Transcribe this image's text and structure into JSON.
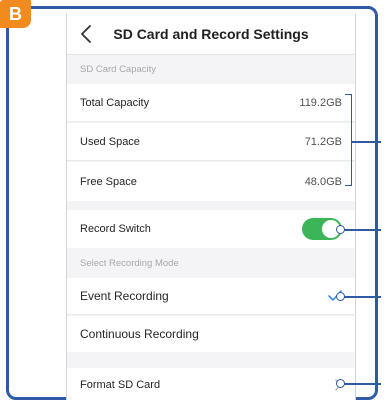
{
  "badge": "B",
  "header": {
    "title": "SD Card and Record Settings"
  },
  "capacity": {
    "section_label": "SD Card Capacity",
    "rows": [
      {
        "label": "Total Capacity",
        "value": "119.2GB"
      },
      {
        "label": "Used Space",
        "value": "71.2GB"
      },
      {
        "label": "Free Space",
        "value": "48.0GB"
      }
    ]
  },
  "record": {
    "label": "Record Switch",
    "enabled": true
  },
  "mode": {
    "section_label": "Select Recording Mode",
    "options": [
      {
        "label": "Event Recording",
        "selected": true
      },
      {
        "label": "Continuous Recording",
        "selected": false
      }
    ]
  },
  "format": {
    "label": "Format SD Card"
  },
  "colors": {
    "accent": "#3b8ee3",
    "toggle_on": "#3bb558",
    "callout": "#2e5aa8",
    "badge": "#f28b1e"
  },
  "icons": [
    "chevron-left-icon",
    "checkmark-icon",
    "chevron-right-icon"
  ]
}
